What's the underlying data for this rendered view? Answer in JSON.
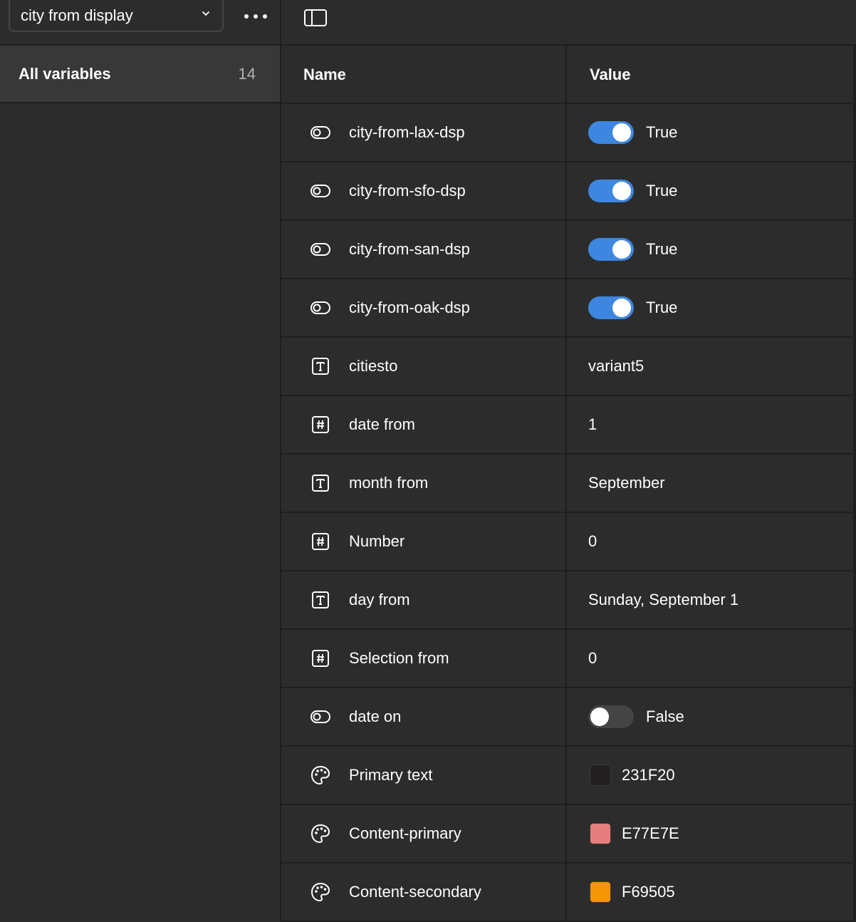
{
  "sidebar": {
    "collection_name": "city from display",
    "all_variables": {
      "label": "All variables",
      "count": "14"
    }
  },
  "table": {
    "headers": {
      "name": "Name",
      "value": "Value"
    },
    "rows": [
      {
        "name": "city-from-lax-dsp",
        "type": "boolean",
        "type_icon": "toggle-icon",
        "value": "True",
        "on": true
      },
      {
        "name": "city-from-sfo-dsp",
        "type": "boolean",
        "type_icon": "toggle-icon",
        "value": "True",
        "on": true
      },
      {
        "name": "city-from-san-dsp",
        "type": "boolean",
        "type_icon": "toggle-icon",
        "value": "True",
        "on": true
      },
      {
        "name": "city-from-oak-dsp",
        "type": "boolean",
        "type_icon": "toggle-icon",
        "value": "True",
        "on": true
      },
      {
        "name": "citiesto",
        "type": "string",
        "type_icon": "text-type-icon",
        "value": "variant5"
      },
      {
        "name": "date from",
        "type": "number",
        "type_icon": "number-type-icon",
        "value": "1"
      },
      {
        "name": "month from",
        "type": "string",
        "type_icon": "text-type-icon",
        "value": "September"
      },
      {
        "name": "Number",
        "type": "number",
        "type_icon": "number-type-icon",
        "value": "0"
      },
      {
        "name": "day from",
        "type": "string",
        "type_icon": "text-type-icon",
        "value": "Sunday, September 1"
      },
      {
        "name": "Selection from",
        "type": "number",
        "type_icon": "number-type-icon",
        "value": "0"
      },
      {
        "name": "date on",
        "type": "boolean",
        "type_icon": "toggle-icon",
        "value": "False",
        "on": false
      },
      {
        "name": "Primary text",
        "type": "color",
        "type_icon": "palette-icon",
        "value": "231F20",
        "color": "#231F20"
      },
      {
        "name": "Content-primary",
        "type": "color",
        "type_icon": "palette-icon",
        "value": "E77E7E",
        "color": "#E77E7E"
      },
      {
        "name": "Content-secondary",
        "type": "color",
        "type_icon": "palette-icon",
        "value": "F69505",
        "color": "#F69505"
      }
    ]
  },
  "colors": {
    "accent": "#3e87e0",
    "background": "#2c2c2c",
    "divider": "#1e1e1e"
  }
}
